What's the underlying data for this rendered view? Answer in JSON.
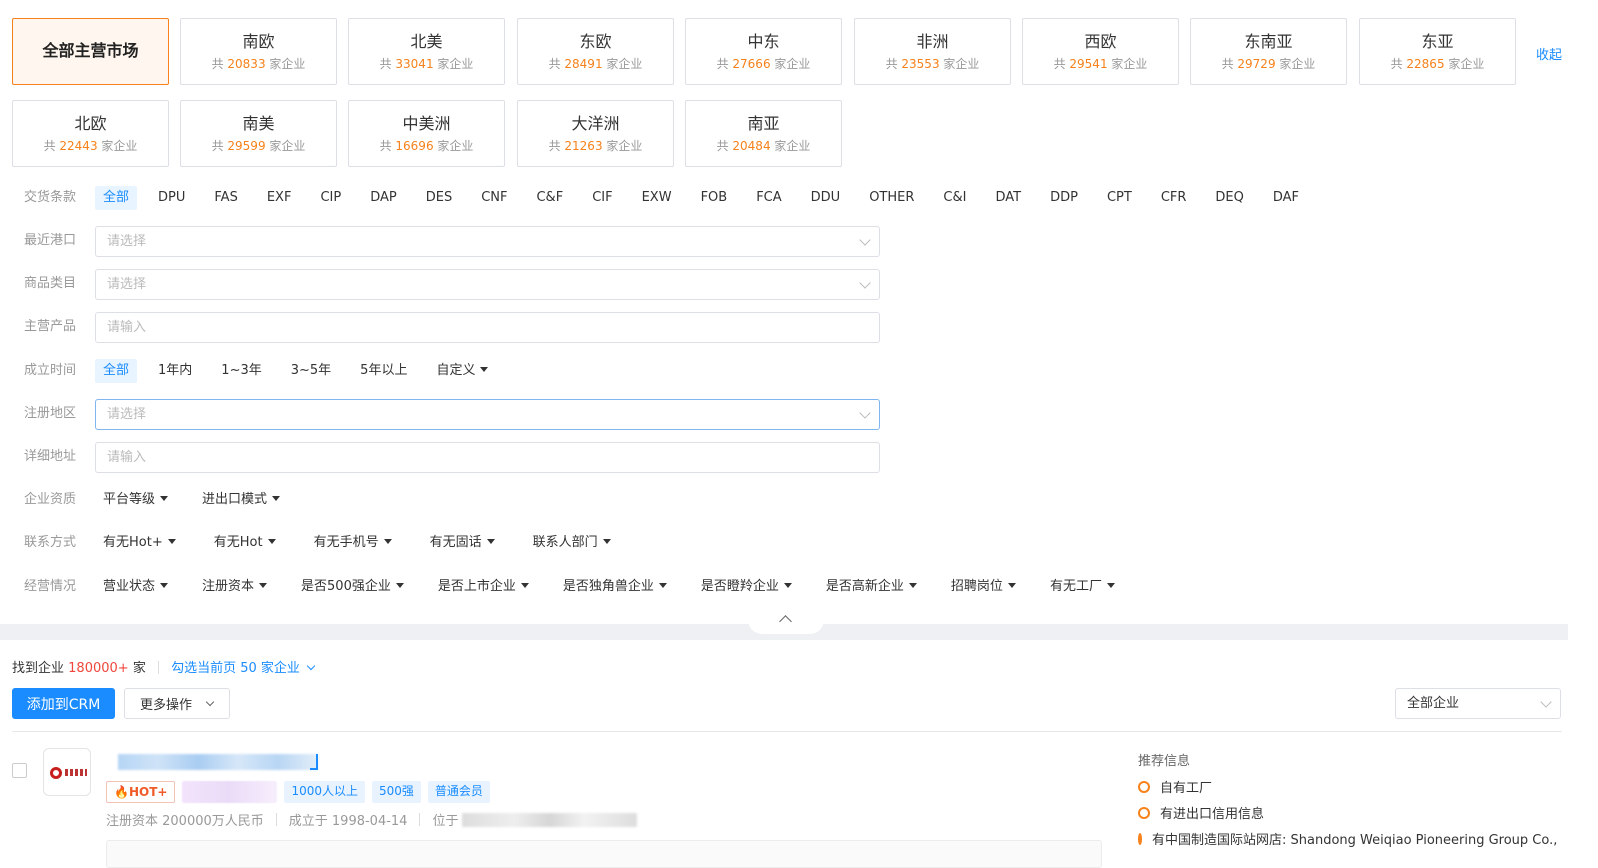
{
  "regions": {
    "all_label": "全部主营市场",
    "count_prefix": "共",
    "count_suffix": "家企业",
    "items": [
      {
        "name": "南欧",
        "count": "20833"
      },
      {
        "name": "北美",
        "count": "33041"
      },
      {
        "name": "东欧",
        "count": "28491"
      },
      {
        "name": "中东",
        "count": "27666"
      },
      {
        "name": "非洲",
        "count": "23553"
      },
      {
        "name": "西欧",
        "count": "29541"
      },
      {
        "name": "东南亚",
        "count": "29729"
      },
      {
        "name": "东亚",
        "count": "22865"
      },
      {
        "name": "北欧",
        "count": "22443"
      },
      {
        "name": "南美",
        "count": "29599"
      },
      {
        "name": "中美洲",
        "count": "16696"
      },
      {
        "name": "大洋洲",
        "count": "21263"
      },
      {
        "name": "南亚",
        "count": "20484"
      }
    ],
    "collapse_label": "收起"
  },
  "filters": {
    "delivery": {
      "label": "交货条款",
      "options": [
        "全部",
        "DPU",
        "FAS",
        "EXF",
        "CIP",
        "DAP",
        "DES",
        "CNF",
        "C&F",
        "CIF",
        "EXW",
        "FOB",
        "FCA",
        "DDU",
        "OTHER",
        "C&I",
        "DAT",
        "DDP",
        "CPT",
        "CFR",
        "DEQ",
        "DAF"
      ]
    },
    "port": {
      "label": "最近港口",
      "placeholder": "请选择"
    },
    "category": {
      "label": "商品类目",
      "placeholder": "请选择"
    },
    "product": {
      "label": "主营产品",
      "placeholder": "请输入"
    },
    "founded": {
      "label": "成立时间",
      "options": [
        "全部",
        "1年内",
        "1~3年",
        "3~5年",
        "5年以上"
      ],
      "custom": "自定义"
    },
    "reg_region": {
      "label": "注册地区",
      "placeholder": "请选择"
    },
    "address": {
      "label": "详细地址",
      "placeholder": "请输入"
    },
    "qualification": {
      "label": "企业资质",
      "dropdowns": [
        "平台等级",
        "进出口模式"
      ]
    },
    "contact": {
      "label": "联系方式",
      "dropdowns": [
        "有无Hot+",
        "有无Hot",
        "有无手机号",
        "有无固话",
        "联系人部门"
      ]
    },
    "business": {
      "label": "经营情况",
      "dropdowns": [
        "营业状态",
        "注册资本",
        "是否500强企业",
        "是否上市企业",
        "是否独角兽企业",
        "是否瞪羚企业",
        "是否高新企业",
        "招聘岗位",
        "有无工厂"
      ]
    }
  },
  "results": {
    "found_prefix": "找到企业",
    "found_count": "180000+",
    "found_suffix": "家",
    "select_page": "勾选当前页 50 家企业",
    "add_crm": "添加到CRM",
    "more_ops": "更多操作",
    "scope_select": "全部企业"
  },
  "company": {
    "tags": {
      "hot": "HOT+",
      "staff": "1000人以上",
      "rank": "500强",
      "member": "普通会员"
    },
    "capital": "注册资本 200000万人民币",
    "founded": "成立于 1998-04-14",
    "location_prefix": "位于"
  },
  "recommend": {
    "title": "推荐信息",
    "items": [
      "自有工厂",
      "有进出口信用信息",
      "有中国制造国际站网店: Shandong Weiqiao Pioneering Group Co., L"
    ]
  },
  "colors": {
    "accent": "#1a8cff",
    "orange": "#f7811a",
    "red": "#f0463c"
  }
}
